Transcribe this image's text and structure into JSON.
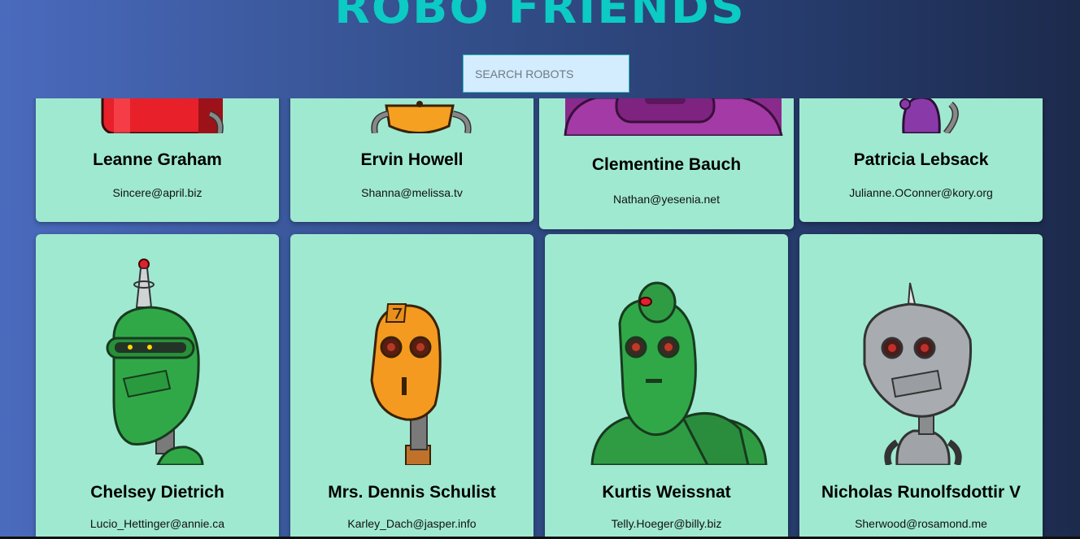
{
  "app": {
    "title": "ROBO FRIENDS"
  },
  "search": {
    "placeholder": "SEARCH ROBOTS"
  },
  "robots": [
    {
      "name": "Leanne Graham",
      "email": "Sincere@april.biz"
    },
    {
      "name": "Ervin Howell",
      "email": "Shanna@melissa.tv"
    },
    {
      "name": "Clementine Bauch",
      "email": "Nathan@yesenia.net"
    },
    {
      "name": "Patricia Lebsack",
      "email": "Julianne.OConner@kory.org"
    },
    {
      "name": "Chelsey Dietrich",
      "email": "Lucio_Hettinger@annie.ca"
    },
    {
      "name": "Mrs. Dennis Schulist",
      "email": "Karley_Dach@jasper.info"
    },
    {
      "name": "Kurtis Weissnat",
      "email": "Telly.Hoeger@billy.biz"
    },
    {
      "name": "Nicholas Runolfsdottir V",
      "email": "Sherwood@rosamond.me"
    }
  ],
  "colors": {
    "card_background": "#9fe9d1",
    "title_accent": "#0ccac4",
    "search_background": "#d3ecfe"
  }
}
